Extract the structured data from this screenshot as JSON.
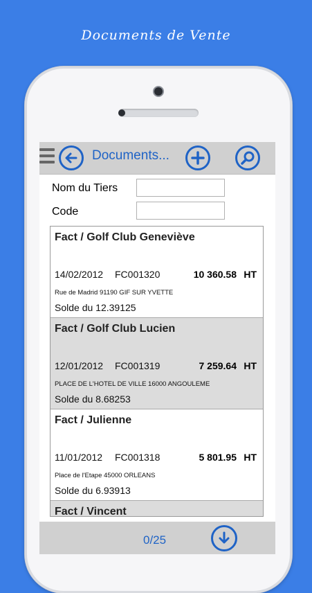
{
  "promo": {
    "title": "Documents de Vente"
  },
  "toolbar": {
    "title": "Documents..."
  },
  "icons": {
    "menu": "menu-icon",
    "back": "arrow-left-icon",
    "add": "plus-icon",
    "search": "search-icon",
    "next": "arrow-down-icon"
  },
  "colors": {
    "background": "#3b7ee6",
    "accent": "#1f63c6",
    "bar": "#d0d0d0",
    "row_alt": "#dcdcdc"
  },
  "form": {
    "tiers_label": "Nom du Tiers",
    "tiers_value": "",
    "code_label": "Code",
    "code_value": ""
  },
  "documents": [
    {
      "title": "Fact / Golf Club Geneviève",
      "date": "14/02/2012",
      "number": "FC001320",
      "amount": "10 360.58",
      "tax": "HT",
      "address": "Rue de Madrid 91190 GIF SUR YVETTE",
      "balance": "Solde du 12.39125"
    },
    {
      "title": "Fact / Golf Club Lucien",
      "date": "12/01/2012",
      "number": "FC001319",
      "amount": "7 259.64",
      "tax": "HT",
      "address": "PLACE DE L'HOTEL DE VILLE 16000 ANGOULEME",
      "balance": "Solde du 8.68253"
    },
    {
      "title": "Fact / Julienne",
      "date": "11/01/2012",
      "number": "FC001318",
      "amount": "5 801.95",
      "tax": "HT",
      "address": "Place de l'Etape 45000 ORLEANS",
      "balance": "Solde du 6.93913"
    },
    {
      "title": "Fact / Vincent"
    }
  ],
  "pager": {
    "label": "0/25"
  }
}
